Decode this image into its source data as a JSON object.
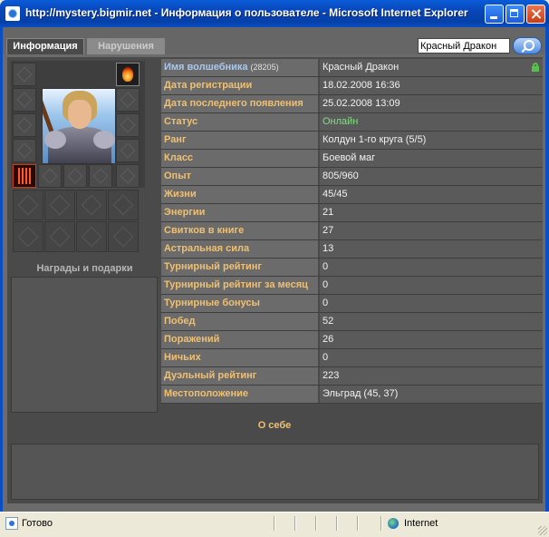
{
  "window": {
    "title": "http://mystery.bigmir.net - Информация о пользователе - Microsoft Internet Explorer"
  },
  "tabs": [
    {
      "label": "Информация",
      "active": true
    },
    {
      "label": "Нарушения",
      "active": false
    }
  ],
  "search": {
    "value": "Красный Дракон"
  },
  "sidebar": {
    "awards_title": "Награды и подарки"
  },
  "profile": {
    "wizard_label": "Имя волшебника",
    "wizard_id": "(28205)",
    "wizard_name": "Красный Дракон",
    "rows": [
      {
        "label": "Дата регистрации",
        "value": "18.02.2008 16:36"
      },
      {
        "label": "Дата последнего появления",
        "value": "25.02.2008 13:09"
      },
      {
        "label": "Статус",
        "value": "Онлайн"
      },
      {
        "label": "Ранг",
        "value": "Колдун 1-го круга (5/5)"
      },
      {
        "label": "Класс",
        "value": "Боевой маг"
      },
      {
        "label": "Опыт",
        "value": "805/960"
      },
      {
        "label": "Жизни",
        "value": "45/45"
      },
      {
        "label": "Энергии",
        "value": "21"
      },
      {
        "label": "Свитков в книге",
        "value": "27"
      },
      {
        "label": "Астральная сила",
        "value": "13"
      },
      {
        "label": "Турнирный рейтинг",
        "value": "0"
      },
      {
        "label": "Турнирный рейтинг за месяц",
        "value": "0"
      },
      {
        "label": "Турнирные бонусы",
        "value": "0"
      },
      {
        "label": "Побед",
        "value": "52"
      },
      {
        "label": "Поражений",
        "value": "26"
      },
      {
        "label": "Ничьих",
        "value": "0"
      },
      {
        "label": "Дуэльный рейтинг",
        "value": "223"
      },
      {
        "label": "Местоположение",
        "value": "Эльград (45, 37)"
      }
    ],
    "about_title": "О себе"
  },
  "statusbar": {
    "text": "Готово",
    "zone": "Internet"
  },
  "colors": {
    "label": "#f0c070",
    "wizard_label": "#a8c8f0",
    "online": "#7fe07f",
    "panel": "#4a4a4a"
  }
}
